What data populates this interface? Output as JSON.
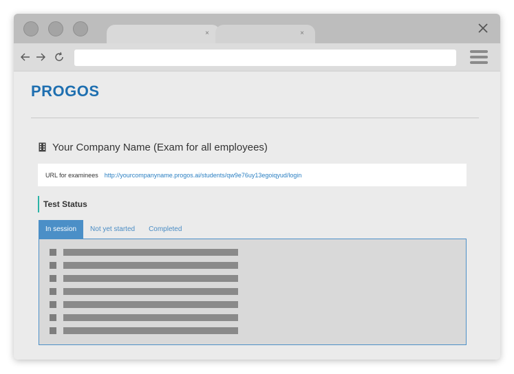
{
  "browser": {
    "tabs": [
      {
        "close_glyph": "×",
        "active": true
      },
      {
        "close_glyph": "×",
        "active": false
      }
    ],
    "window_close_icon": "close-icon",
    "nav": {
      "back_icon": "arrow-left-icon",
      "forward_icon": "arrow-right-icon",
      "reload_icon": "reload-icon"
    },
    "address_bar_value": "",
    "menu_icon": "hamburger-icon"
  },
  "page": {
    "logo": "PROGOS",
    "company": {
      "icon": "building-icon",
      "title": "Your Company Name (Exam for all employees)"
    },
    "examinee_url": {
      "label": "URL for examinees",
      "link": "http://yourcompanyname.progos.ai/students/qw9e76uy13egoiqyud/login"
    },
    "test_status": {
      "heading": "Test Status",
      "tabs": [
        {
          "label": "In session",
          "active": true
        },
        {
          "label": "Not yet started",
          "active": false
        },
        {
          "label": "Completed",
          "active": false
        }
      ],
      "placeholder_rows": 7
    }
  },
  "colors": {
    "brand": "#1e6fb0",
    "accent_tab": "#4b8fc7",
    "link": "#2a7fc2",
    "heading_bar": "#2bb3a6"
  }
}
